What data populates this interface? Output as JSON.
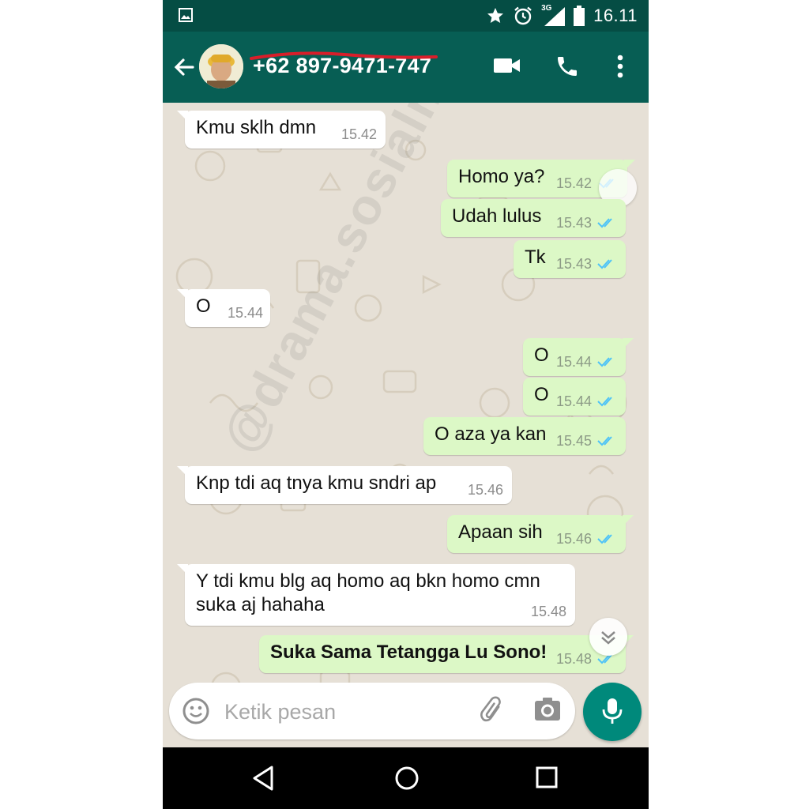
{
  "status_bar": {
    "network": "3G",
    "time": "16.11"
  },
  "header": {
    "contact_name": "+62 897-9471-747"
  },
  "watermark": "@drama.sosialmedia",
  "messages": [
    {
      "dir": "in",
      "text": "Kmu sklh dmn",
      "time": "15.42"
    },
    {
      "dir": "out",
      "text": "Homo ya?",
      "time": "15.42"
    },
    {
      "dir": "out",
      "text": "Udah lulus",
      "time": "15.43"
    },
    {
      "dir": "out",
      "text": "Tk",
      "time": "15.43"
    },
    {
      "dir": "in",
      "text": "O",
      "time": "15.44"
    },
    {
      "dir": "out",
      "text": "O",
      "time": "15.44"
    },
    {
      "dir": "out",
      "text": "O",
      "time": "15.44"
    },
    {
      "dir": "out",
      "text": "O aza ya kan",
      "time": "15.45"
    },
    {
      "dir": "in",
      "text": "Knp tdi aq tnya kmu sndri ap",
      "time": "15.46"
    },
    {
      "dir": "out",
      "text": "Apaan sih",
      "time": "15.46"
    },
    {
      "dir": "in",
      "text": "Y tdi kmu blg aq homo aq bkn homo cmn",
      "text2": "suka aj hahaha",
      "time": "15.48"
    },
    {
      "dir": "out",
      "text": "Suka Sama Tetangga Lu Sono!",
      "time": "15.48"
    }
  ],
  "composer": {
    "placeholder": "Ketik pesan"
  },
  "colors": {
    "header": "#075e54",
    "statusbar": "#054d44",
    "outgoing_bubble": "#dcf8c6",
    "incoming_bubble": "#ffffff",
    "read_ticks": "#4fc3f7",
    "fab": "#00897b"
  },
  "icons": [
    "image-icon",
    "star-icon",
    "alarm-icon",
    "signal-icon",
    "battery-icon",
    "back-arrow-icon",
    "video-call-icon",
    "phone-icon",
    "more-vert-icon",
    "emoji-icon",
    "attach-icon",
    "camera-icon",
    "mic-icon",
    "nav-back-icon",
    "nav-home-icon",
    "nav-recents-icon"
  ]
}
